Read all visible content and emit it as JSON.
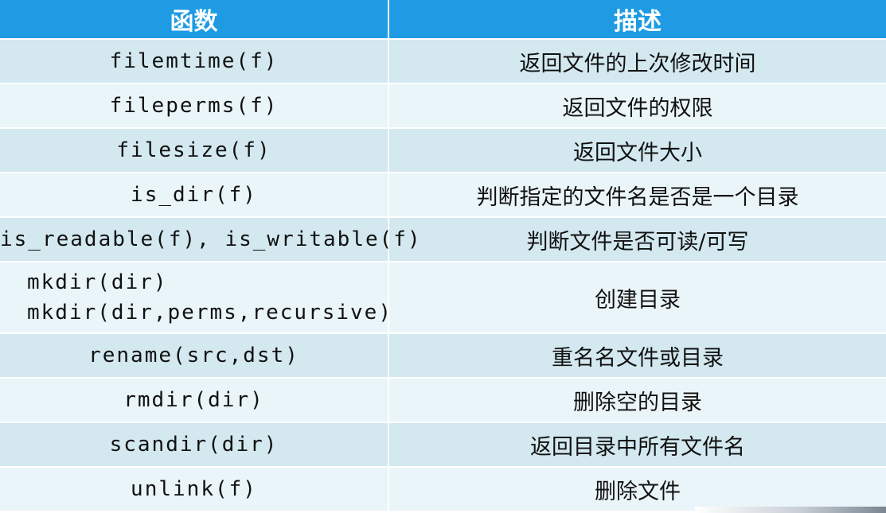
{
  "table": {
    "headers": [
      "函数",
      "描述"
    ],
    "rows": [
      {
        "fn": [
          "filemtime(f)"
        ],
        "desc": "返回文件的上次修改时间"
      },
      {
        "fn": [
          "fileperms(f)"
        ],
        "desc": "返回文件的权限"
      },
      {
        "fn": [
          "filesize(f)"
        ],
        "desc": "返回文件大小"
      },
      {
        "fn": [
          "is_dir(f)"
        ],
        "desc": "判断指定的文件名是否是一个目录"
      },
      {
        "fn": [
          "is_readable(f), is_writable(f)"
        ],
        "desc": "判断文件是否可读/可写"
      },
      {
        "fn": [
          "mkdir(dir)",
          "mkdir(dir,perms,recursive)"
        ],
        "desc": "创建目录"
      },
      {
        "fn": [
          "rename(src,dst)"
        ],
        "desc": "重名名文件或目录"
      },
      {
        "fn": [
          "rmdir(dir)"
        ],
        "desc": "删除空的目录"
      },
      {
        "fn": [
          "scandir(dir)"
        ],
        "desc": "返回目录中所有文件名"
      },
      {
        "fn": [
          "unlink(f)"
        ],
        "desc": "删除文件"
      }
    ]
  },
  "colors": {
    "header_bg": "#1e9be3",
    "row_odd": "#d3e8ef",
    "row_even": "#eaf5f9"
  }
}
